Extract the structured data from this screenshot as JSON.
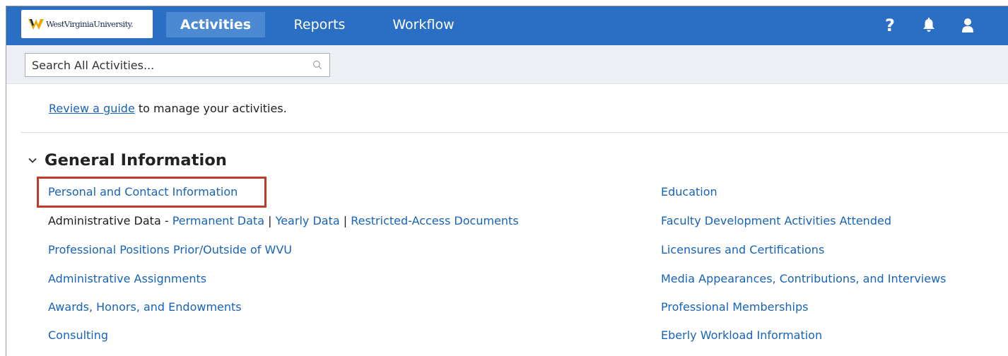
{
  "header": {
    "logo_text": "WestVirginiaUniversity.",
    "tabs": [
      {
        "label": "Activities",
        "active": true
      },
      {
        "label": "Reports",
        "active": false
      },
      {
        "label": "Workflow",
        "active": false
      }
    ],
    "help_label": "?",
    "accent_color": "#2a6fc4"
  },
  "search": {
    "placeholder": "Search All Activities...",
    "value": ""
  },
  "guide": {
    "link_text": "Review a guide",
    "rest_text": " to manage your activities."
  },
  "section": {
    "title": "General Information",
    "left_items": [
      "Personal and Contact Information",
      "Professional Positions Prior/Outside of WVU",
      "Administrative Assignments",
      "Awards, Honors, and Endowments",
      "Consulting"
    ],
    "admin_row": {
      "prefix": "Administrative Data - ",
      "link1": "Permanent Data",
      "sep1": " | ",
      "link2": "Yearly Data",
      "sep2": " | ",
      "link3": "Restricted-Access Documents"
    },
    "right_items": [
      "Education",
      "Faculty Development Activities Attended",
      "Licensures and Certifications",
      "Media Appearances, Contributions, and Interviews",
      "Professional Memberships",
      "Eberly Workload Information"
    ]
  }
}
